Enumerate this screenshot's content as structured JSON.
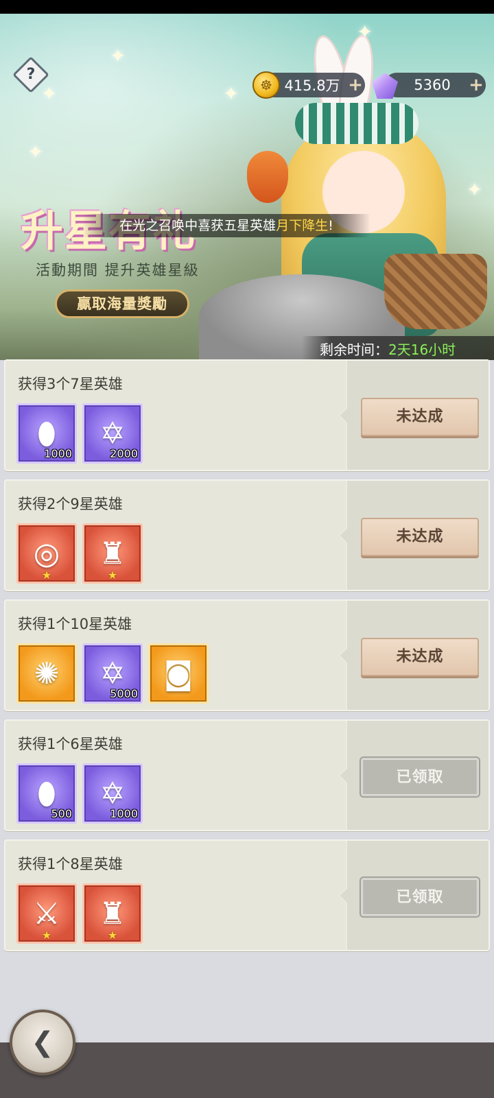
{
  "header": {
    "help_icon": "?",
    "gold": "415.8万",
    "gems": "5360",
    "plus": "+"
  },
  "event": {
    "title": "升星有礼",
    "subtitle": "活動期間 提升英雄星級",
    "button": "贏取海量獎勵",
    "marquee_prefix": "在光之召唤中喜获五星英雄",
    "marquee_name": "月下降生",
    "marquee_suffix": "!",
    "timer_label": "剩余时间：",
    "timer_value": "2天16小时"
  },
  "tasks": [
    {
      "title": "获得3个7星英雄",
      "status": "未达成",
      "items": [
        {
          "icon": "soul-egg-icon",
          "rarity": "purple",
          "qty": "1000"
        },
        {
          "icon": "star-coin-icon",
          "rarity": "purple",
          "qty": "2000"
        }
      ]
    },
    {
      "title": "获得2个9星英雄",
      "status": "未达成",
      "items": [
        {
          "icon": "ring-icon",
          "rarity": "red",
          "stars": "★"
        },
        {
          "icon": "armor-icon",
          "rarity": "red",
          "stars": "★"
        }
      ]
    },
    {
      "title": "获得1个10星英雄",
      "status": "未达成",
      "items": [
        {
          "icon": "vortex-emblem-icon",
          "rarity": "orange"
        },
        {
          "icon": "star-coin-icon",
          "rarity": "purple",
          "qty": "5000"
        },
        {
          "icon": "frame-icon",
          "rarity": "orange"
        }
      ]
    },
    {
      "title": "获得1个6星英雄",
      "status": "已领取",
      "items": [
        {
          "icon": "soul-egg-icon",
          "rarity": "purple",
          "qty": "500"
        },
        {
          "icon": "star-coin-icon",
          "rarity": "purple",
          "qty": "1000"
        }
      ]
    },
    {
      "title": "获得1个8星英雄",
      "status": "已领取",
      "items": [
        {
          "icon": "weapon-icon",
          "rarity": "red",
          "stars": "★"
        },
        {
          "icon": "chest-armor-icon",
          "rarity": "red",
          "stars": "★"
        }
      ]
    }
  ],
  "colors": {
    "timer_value": "#8bf05a",
    "marquee_highlight": "#ffd84a",
    "pending_button": "#e6cdb6",
    "claimed_button": "#b9b8b1"
  }
}
